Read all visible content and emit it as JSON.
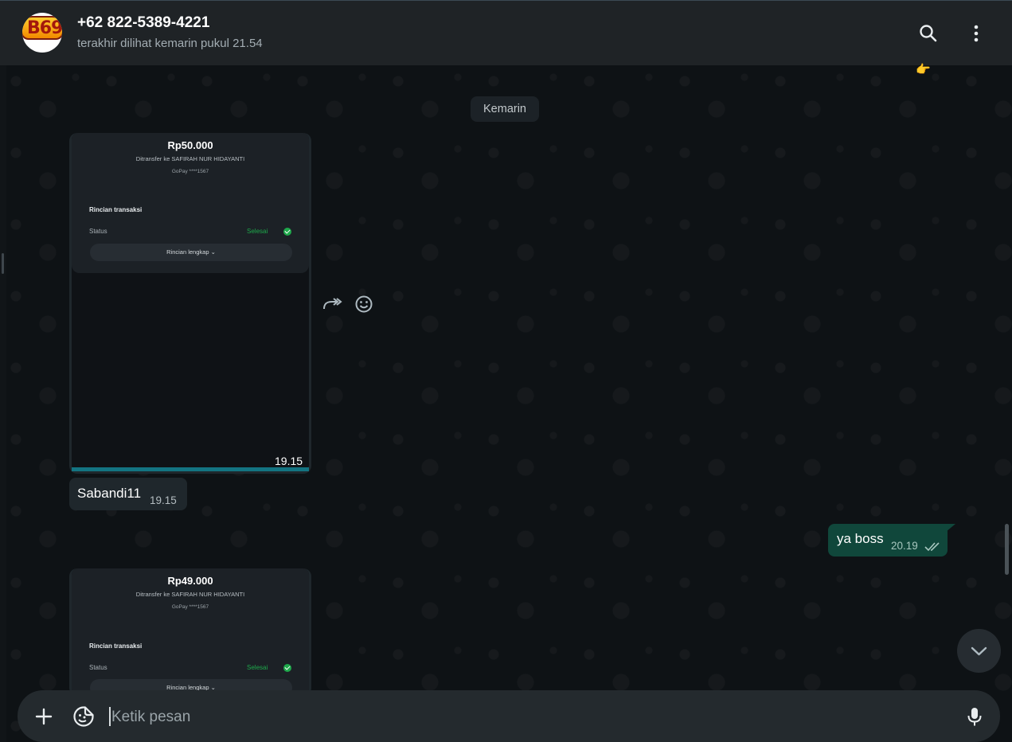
{
  "header": {
    "contact_name": "+62 822-5389-4221",
    "last_seen": "terakhir dilihat kemarin pukul 21.54",
    "avatar_text": "B69"
  },
  "chat": {
    "date_separator": "Kemarin",
    "messages": [
      {
        "type": "image",
        "receipt": {
          "amount": "Rp50.000",
          "transfer_to": "Ditransfer ke SAFIRAH NUR HIDAYANTI",
          "account": "GoPay ****1567",
          "section_title": "Rincian transaksi",
          "status_label": "Status",
          "status_value": "Selesai",
          "details_button": "Rincian lengkap"
        },
        "time": "19.15"
      },
      {
        "type": "text",
        "direction": "in",
        "text": "Sabandi11",
        "time": "19.15"
      },
      {
        "type": "text",
        "direction": "out",
        "text": "ya boss",
        "time": "20.19"
      },
      {
        "type": "image",
        "receipt": {
          "amount": "Rp49.000",
          "transfer_to": "Ditransfer ke SAFIRAH NUR HIDAYANTI",
          "account": "GoPay ****1567",
          "section_title": "Rincian transaksi",
          "status_label": "Status",
          "status_value": "Selesai",
          "details_button": "Rincian lengkap"
        }
      }
    ]
  },
  "composer": {
    "placeholder": "Ketik pesan"
  },
  "icons": {
    "header": [
      "search-icon",
      "menu-kebab-icon"
    ],
    "message_actions": [
      "forward-icon",
      "emoji-reaction-icon"
    ],
    "composer": [
      "plus-icon",
      "sticker-icon",
      "microphone-icon"
    ],
    "scroll": "chevron-down-icon"
  },
  "colors": {
    "header_bg": "#1f2326",
    "outgoing_bubble": "#10473b",
    "incoming_bubble": "#1f272c",
    "status_green": "#1ea94b"
  }
}
